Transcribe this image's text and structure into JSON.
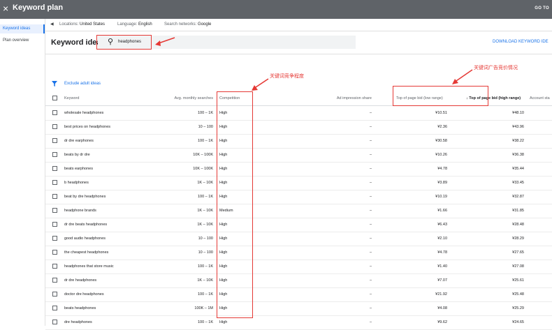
{
  "topbar": {
    "close_glyph": "×",
    "title": "Keyword plan",
    "go_to": "GO TO"
  },
  "sidebar": {
    "items": [
      {
        "label": "Keyword ideas",
        "active": true
      },
      {
        "label": "Plan overview",
        "active": false
      }
    ]
  },
  "filters": {
    "location_label": "Locations:",
    "location_value": "United States",
    "language_label": "Language:",
    "language_value": "English",
    "network_label": "Search networks:",
    "network_value": "Google"
  },
  "main": {
    "heading": "Keyword ideas",
    "search_value": "headphones",
    "download_label": "DOWNLOAD KEYWORD IDE",
    "exclude_label": "Exclude adult ideas"
  },
  "annotations": {
    "competition_note": "关键词竞争程度",
    "bid_note": "关键词广告竞价情况"
  },
  "table": {
    "headers": {
      "keyword": "Keyword",
      "avg": "Avg. monthly searches",
      "competition": "Competition",
      "impression": "Ad impression share",
      "low_bid": "Top of page bid (low range)",
      "high_bid": "Top of page bid (high range)",
      "account": "Account sta"
    },
    "sort_glyph": "↓",
    "rows": [
      {
        "keyword": "wholesale headphones",
        "avg": "100 – 1K",
        "competition": "High",
        "impression": "–",
        "low": "¥10.51",
        "high": "¥48.10"
      },
      {
        "keyword": "best prices on headphones",
        "avg": "10 – 100",
        "competition": "High",
        "impression": "–",
        "low": "¥2.36",
        "high": "¥43.96"
      },
      {
        "keyword": "dr dre earphones",
        "avg": "100 – 1K",
        "competition": "High",
        "impression": "–",
        "low": "¥30.58",
        "high": "¥38.22"
      },
      {
        "keyword": "beats by dr dre",
        "avg": "10K – 100K",
        "competition": "High",
        "impression": "–",
        "low": "¥10.26",
        "high": "¥36.38"
      },
      {
        "keyword": "beats earphones",
        "avg": "10K – 100K",
        "competition": "High",
        "impression": "–",
        "low": "¥4.78",
        "high": "¥35.44"
      },
      {
        "keyword": "b headphones",
        "avg": "1K – 10K",
        "competition": "High",
        "impression": "–",
        "low": "¥3.89",
        "high": "¥33.45"
      },
      {
        "keyword": "beat by dre headphones",
        "avg": "100 – 1K",
        "competition": "High",
        "impression": "–",
        "low": "¥10.19",
        "high": "¥32.87"
      },
      {
        "keyword": "headphone brands",
        "avg": "1K – 10K",
        "competition": "Medium",
        "impression": "–",
        "low": "¥1.66",
        "high": "¥31.85"
      },
      {
        "keyword": "dr dre beats headphones",
        "avg": "1K – 10K",
        "competition": "High",
        "impression": "–",
        "low": "¥6.43",
        "high": "¥28.48"
      },
      {
        "keyword": "good audio headphones",
        "avg": "10 – 100",
        "competition": "High",
        "impression": "–",
        "low": "¥2.10",
        "high": "¥28.29"
      },
      {
        "keyword": "the cheapest headphones",
        "avg": "10 – 100",
        "competition": "High",
        "impression": "–",
        "low": "¥4.78",
        "high": "¥27.65"
      },
      {
        "keyword": "headphones that store music",
        "avg": "100 – 1K",
        "competition": "High",
        "impression": "–",
        "low": "¥1.40",
        "high": "¥27.08"
      },
      {
        "keyword": "dr dre headphones",
        "avg": "1K – 10K",
        "competition": "High",
        "impression": "–",
        "low": "¥7.07",
        "high": "¥25.61"
      },
      {
        "keyword": "doctor dre headphones",
        "avg": "100 – 1K",
        "competition": "High",
        "impression": "–",
        "low": "¥21.92",
        "high": "¥25.48"
      },
      {
        "keyword": "beats headphones",
        "avg": "100K – 1M",
        "competition": "High",
        "impression": "–",
        "low": "¥4.08",
        "high": "¥25.29"
      },
      {
        "keyword": "dre headphones",
        "avg": "100 – 1K",
        "competition": "High",
        "impression": "–",
        "low": "¥9.62",
        "high": "¥24.65"
      }
    ]
  },
  "colors": {
    "topbar": "#5f6368",
    "accent": "#1a73e8",
    "annotation_red": "#e53935"
  }
}
